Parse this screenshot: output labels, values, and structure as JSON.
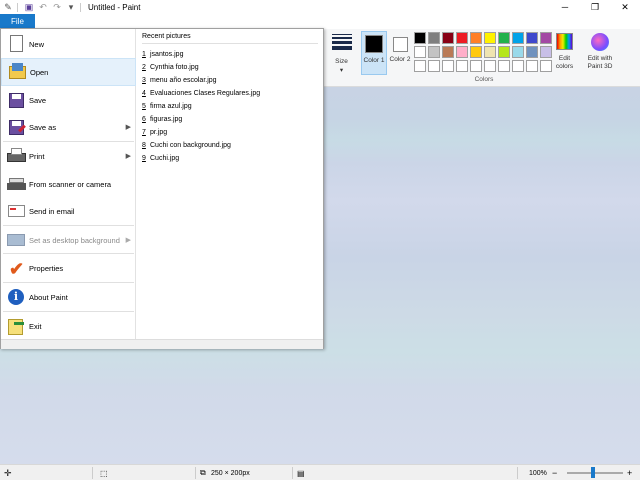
{
  "window": {
    "title": "Untitled - Paint",
    "minimize_icon": "minimize-icon",
    "restore_icon": "restore-icon",
    "close_icon": "close-icon"
  },
  "quick_access": {
    "icons": [
      "paint-app-icon",
      "save-icon",
      "undo-icon",
      "redo-icon",
      "customize-dropdown-icon"
    ]
  },
  "tabs": {
    "file_label": "File"
  },
  "ribbon": {
    "size_label": "Size",
    "color1_label": "Color 1",
    "color1_value": "#000000",
    "color2_label": "Color 2",
    "color2_value": "#ffffff",
    "colors_group_label": "Colors",
    "edit_colors_label": "Edit colors",
    "paint3d_label": "Edit with Paint 3D",
    "palette": [
      "#000000",
      "#7f7f7f",
      "#880015",
      "#ed1c24",
      "#ff7f27",
      "#fff200",
      "#22b14c",
      "#00a2e8",
      "#3f48cc",
      "#a349a4",
      "#ffffff",
      "#c3c3c3",
      "#b97a57",
      "#ffaec9",
      "#ffc90e",
      "#efe4b0",
      "#b5e61d",
      "#99d9ea",
      "#7092be",
      "#c8bfe7",
      "#ffffff",
      "#ffffff",
      "#ffffff",
      "#ffffff",
      "#ffffff",
      "#ffffff",
      "#ffffff",
      "#ffffff",
      "#ffffff",
      "#ffffff"
    ]
  },
  "file_menu": {
    "items": [
      {
        "label": "New",
        "icon": "new-file-icon"
      },
      {
        "label": "Open",
        "icon": "open-folder-icon"
      },
      {
        "label": "Save",
        "icon": "save-disk-icon"
      },
      {
        "label": "Save as",
        "icon": "save-as-icon"
      },
      {
        "label": "Print",
        "icon": "printer-icon"
      },
      {
        "label": "From scanner or camera",
        "icon": "scanner-icon"
      },
      {
        "label": "Send in email",
        "icon": "email-icon"
      },
      {
        "label": "Set as desktop background",
        "icon": "desktop-background-icon"
      },
      {
        "label": "Properties",
        "icon": "properties-check-icon"
      },
      {
        "label": "About Paint",
        "icon": "info-icon"
      },
      {
        "label": "Exit",
        "icon": "exit-icon"
      }
    ],
    "recent_title": "Recent pictures",
    "recent": [
      {
        "num": "1",
        "name": "jsantos.jpg"
      },
      {
        "num": "2",
        "name": "Cynthia foto.jpg"
      },
      {
        "num": "3",
        "name": "menu año escolar.jpg"
      },
      {
        "num": "4",
        "name": "Evaluaciones Clases Regulares.jpg"
      },
      {
        "num": "5",
        "name": "firma azul.jpg"
      },
      {
        "num": "6",
        "name": "figuras.jpg"
      },
      {
        "num": "7",
        "name": "pr.jpg"
      },
      {
        "num": "8",
        "name": "Cuchi con background.jpg"
      },
      {
        "num": "9",
        "name": "Cuchi.jpg"
      }
    ]
  },
  "statusbar": {
    "image_size": "250 × 200px",
    "zoom": "100%",
    "zoom_level_percent": 100
  }
}
